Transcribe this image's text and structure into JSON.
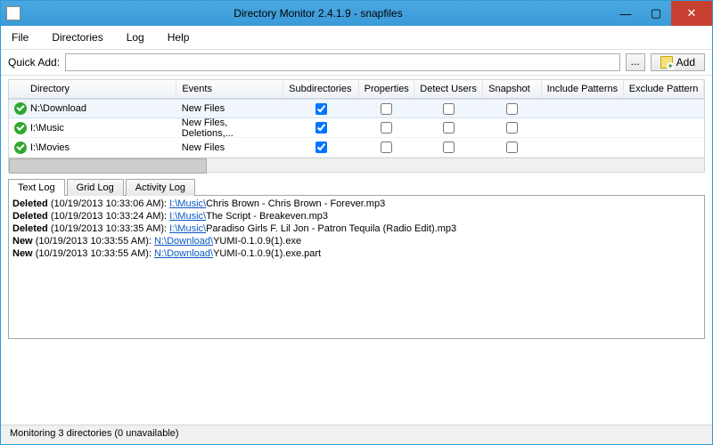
{
  "window": {
    "title": "Directory Monitor 2.4.1.9 - snapfiles"
  },
  "menu": {
    "file": "File",
    "directories": "Directories",
    "log": "Log",
    "help": "Help"
  },
  "toolbar": {
    "quick_add_label": "Quick Add:",
    "browse": "...",
    "add": "Add"
  },
  "grid": {
    "headers": {
      "dir": "Directory",
      "evt": "Events",
      "sub": "Subdirectories",
      "prop": "Properties",
      "det": "Detect Users",
      "snap": "Snapshot",
      "inc": "Include Patterns",
      "exc": "Exclude Pattern"
    },
    "rows": [
      {
        "dir": "N:\\Download",
        "evt": "New Files",
        "sub": true,
        "prop": false,
        "det": false,
        "snap": false
      },
      {
        "dir": "I:\\Music",
        "evt": "New Files, Deletions,...",
        "sub": true,
        "prop": false,
        "det": false,
        "snap": false
      },
      {
        "dir": "I:\\Movies",
        "evt": "New Files",
        "sub": true,
        "prop": false,
        "det": false,
        "snap": false
      }
    ]
  },
  "tabs": {
    "text": "Text Log",
    "grid": "Grid Log",
    "activity": "Activity Log"
  },
  "log": [
    {
      "action": "Deleted",
      "ts": "(10/19/2013 10:33:06 AM): ",
      "path": "I:\\Music\\",
      "file": "Chris Brown - Chris Brown - Forever.mp3"
    },
    {
      "action": "Deleted",
      "ts": "(10/19/2013 10:33:24 AM): ",
      "path": "I:\\Music\\",
      "file": "The Script - Breakeven.mp3"
    },
    {
      "action": "Deleted",
      "ts": "(10/19/2013 10:33:35 AM): ",
      "path": "I:\\Music\\",
      "file": "Paradiso Girls F. Lil Jon - Patron Tequila (Radio Edit).mp3"
    },
    {
      "action": "New",
      "ts": "(10/19/2013 10:33:55 AM): ",
      "path": "N:\\Download\\",
      "file": "YUMI-0.1.0.9(1).exe"
    },
    {
      "action": "New",
      "ts": "(10/19/2013 10:33:55 AM): ",
      "path": "N:\\Download\\",
      "file": "YUMI-0.1.0.9(1).exe.part"
    }
  ],
  "status": "Monitoring 3 directories (0 unavailable)"
}
